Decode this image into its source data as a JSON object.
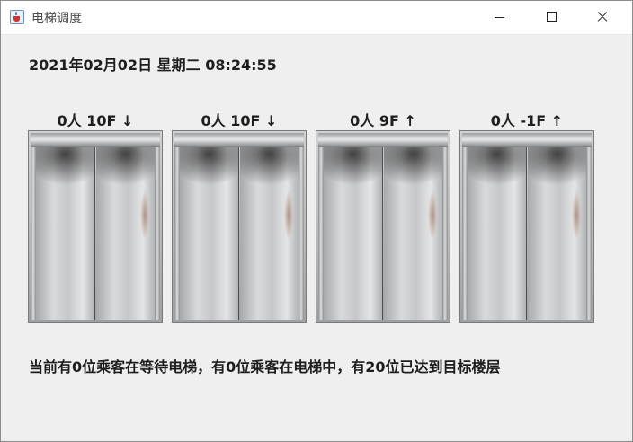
{
  "window": {
    "title": "电梯调度"
  },
  "datetime": "2021年02月02日 星期二 08:24:55",
  "elevators": [
    {
      "label": "0人 10F ↓"
    },
    {
      "label": "0人 10F ↓"
    },
    {
      "label": "0人 9F ↑"
    },
    {
      "label": "0人 -1F ↑"
    }
  ],
  "status": "当前有0位乘客在等待电梯，有0位乘客在电梯中，有20位已达到目标楼层",
  "icons": {
    "app": "java-coffee-cup-icon",
    "minimize": "minimize-icon",
    "maximize": "maximize-icon",
    "close": "close-icon"
  }
}
